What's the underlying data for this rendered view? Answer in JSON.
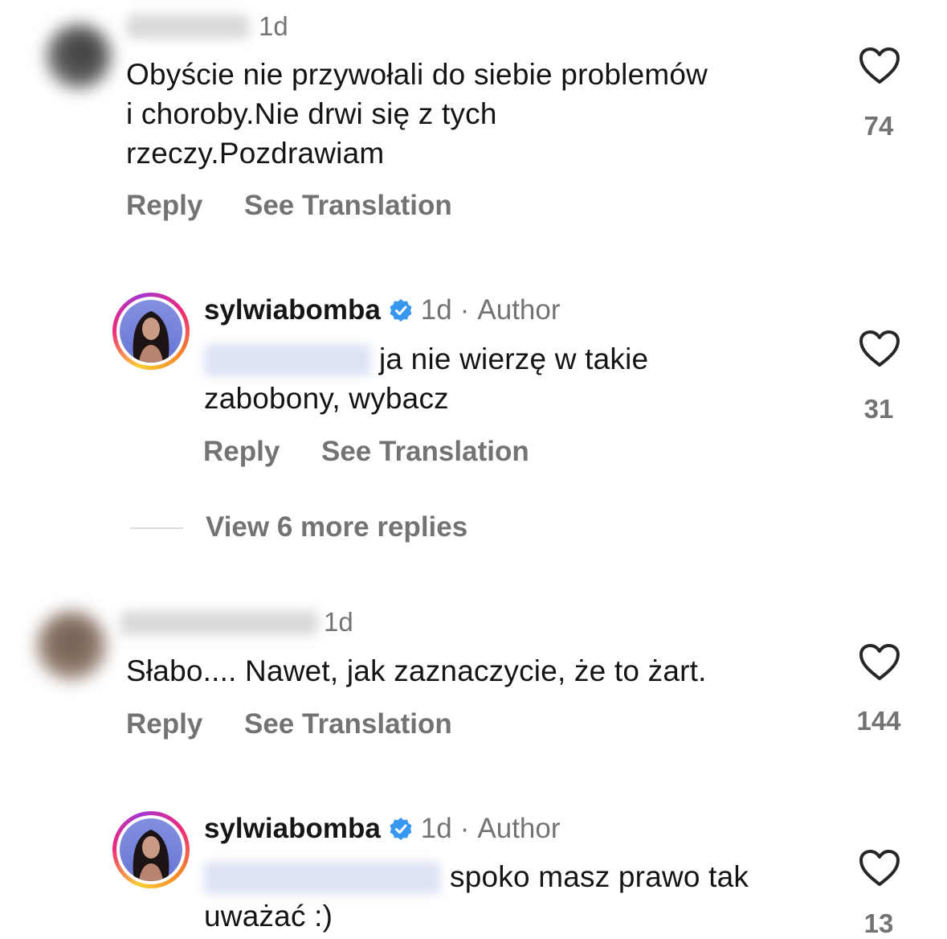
{
  "comments": [
    {
      "time": "1d",
      "text_lines": [
        "Obyście nie przywołali do siebie problemów",
        "i choroby.Nie drwi się z tych",
        "rzeczy.Pozdrawiam"
      ],
      "likes": "74",
      "reply_label": "Reply",
      "translate_label": "See Translation",
      "replies": [
        {
          "username": "sylwiabomba",
          "time": "1d",
          "separator": "·",
          "author_label": "Author",
          "text_lines": [
            "ja nie wierzę w takie",
            "zabobony, wybacz"
          ],
          "likes": "31",
          "reply_label": "Reply",
          "translate_label": "See Translation"
        }
      ],
      "view_more_label": "View 6 more replies"
    },
    {
      "time": "1d",
      "text_lines": [
        "Słabo.... Nawet, jak zaznaczycie, że to żart."
      ],
      "likes": "144",
      "reply_label": "Reply",
      "translate_label": "See Translation",
      "replies": [
        {
          "username": "sylwiabomba",
          "time": "1d",
          "separator": "·",
          "author_label": "Author",
          "text_lines": [
            "spoko masz prawo tak",
            "uważać :)"
          ],
          "likes": "13"
        }
      ]
    }
  ],
  "colors": {
    "muted": "#737373",
    "text": "#141414",
    "verified": "#3897f0",
    "heart_stroke": "#262626"
  },
  "icons": [
    "heart-icon",
    "verified-badge-icon"
  ]
}
